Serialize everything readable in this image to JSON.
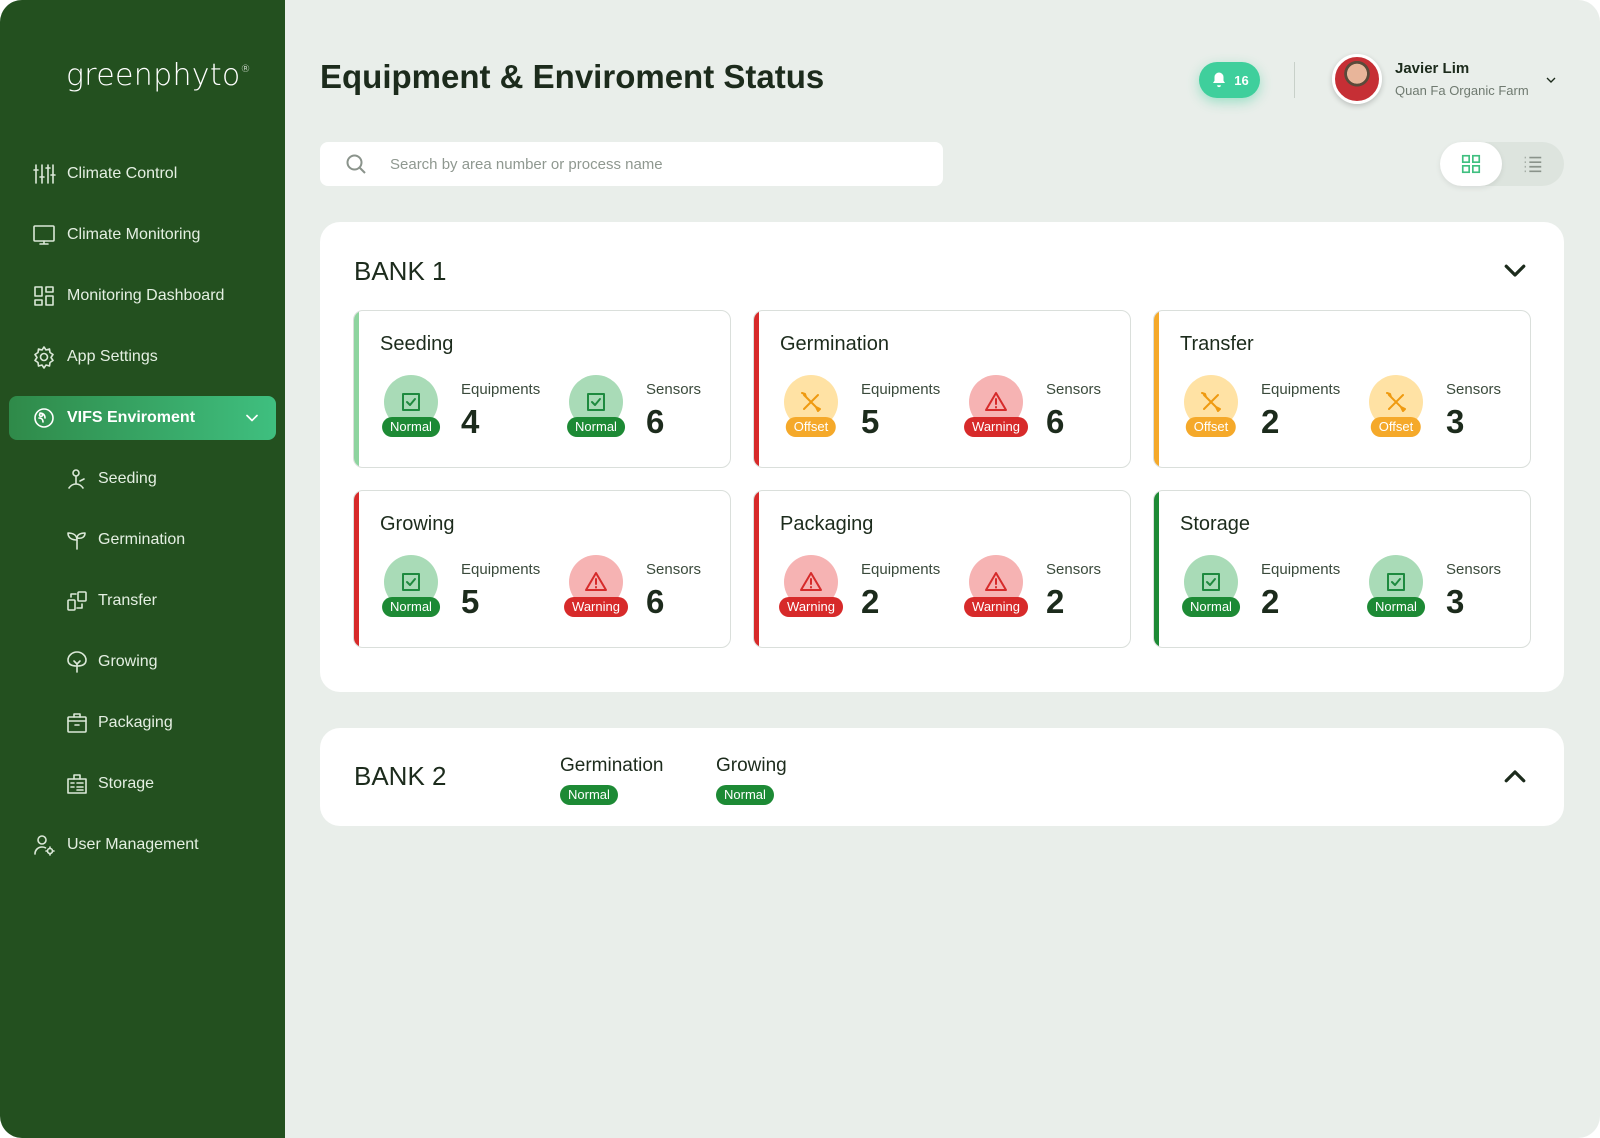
{
  "brand": {
    "logo_text": "greenphyto",
    "trademark": "®"
  },
  "sidebar": {
    "items": [
      {
        "label": "Climate Control",
        "icon": "sliders-icon"
      },
      {
        "label": "Climate Monitoring",
        "icon": "monitor-icon"
      },
      {
        "label": "Monitoring Dashboard",
        "icon": "dashboard-icon"
      },
      {
        "label": "App Settings",
        "icon": "gear-icon"
      },
      {
        "label": "VIFS Enviroment",
        "icon": "environment-icon",
        "active": true,
        "expanded": true
      },
      {
        "label": "Seeding",
        "icon": "seeding-icon",
        "sub": true
      },
      {
        "label": "Germination",
        "icon": "sprout-icon",
        "sub": true
      },
      {
        "label": "Transfer",
        "icon": "transfer-icon",
        "sub": true
      },
      {
        "label": "Growing",
        "icon": "tree-icon",
        "sub": true
      },
      {
        "label": "Packaging",
        "icon": "package-icon",
        "sub": true
      },
      {
        "label": "Storage",
        "icon": "storage-icon",
        "sub": true
      },
      {
        "label": "User Management",
        "icon": "user-settings-icon"
      }
    ]
  },
  "header": {
    "title": "Equipment & Enviroment Status",
    "notifications": {
      "count": "16",
      "icon": "bell-icon"
    },
    "user": {
      "name": "Javier Lim",
      "organization": "Quan Fa Organic Farm"
    }
  },
  "search": {
    "placeholder": "Search by area number or process name",
    "value": ""
  },
  "view_toggle": {
    "selected": "grid",
    "options": [
      "grid-view-icon",
      "list-view-icon"
    ]
  },
  "colors": {
    "sidebar": "#23501f",
    "accent": "#3fcf9c",
    "normal": "#1d8a35",
    "offset": "#f5a92a",
    "warning": "#d72a2a"
  },
  "banks": [
    {
      "title": "BANK 1",
      "expanded": true,
      "processes": [
        {
          "name": "Seeding",
          "bar": "normal",
          "equipments": {
            "label": "Equipments",
            "status": "Normal",
            "count": "4"
          },
          "sensors": {
            "label": "Sensors",
            "status": "Normal",
            "count": "6"
          }
        },
        {
          "name": "Germination",
          "bar": "warning",
          "equipments": {
            "label": "Equipments",
            "status": "Offset",
            "count": "5"
          },
          "sensors": {
            "label": "Sensors",
            "status": "Warning",
            "count": "6"
          }
        },
        {
          "name": "Transfer",
          "bar": "offset",
          "equipments": {
            "label": "Equipments",
            "status": "Offset",
            "count": "2"
          },
          "sensors": {
            "label": "Sensors",
            "status": "Offset",
            "count": "3"
          }
        },
        {
          "name": "Growing",
          "bar": "warning",
          "equipments": {
            "label": "Equipments",
            "status": "Normal",
            "count": "5"
          },
          "sensors": {
            "label": "Sensors",
            "status": "Warning",
            "count": "6"
          }
        },
        {
          "name": "Packaging",
          "bar": "warning",
          "equipments": {
            "label": "Equipments",
            "status": "Warning",
            "count": "2"
          },
          "sensors": {
            "label": "Sensors",
            "status": "Warning",
            "count": "2"
          }
        },
        {
          "name": "Storage",
          "bar": "normal",
          "equipments": {
            "label": "Equipments",
            "status": "Normal",
            "count": "2"
          },
          "sensors": {
            "label": "Sensors",
            "status": "Normal",
            "count": "3"
          }
        }
      ]
    },
    {
      "title": "BANK 2",
      "expanded": false,
      "summary": [
        {
          "name": "Germination",
          "status": "Normal"
        },
        {
          "name": "Growing",
          "status": "Normal"
        }
      ]
    }
  ]
}
